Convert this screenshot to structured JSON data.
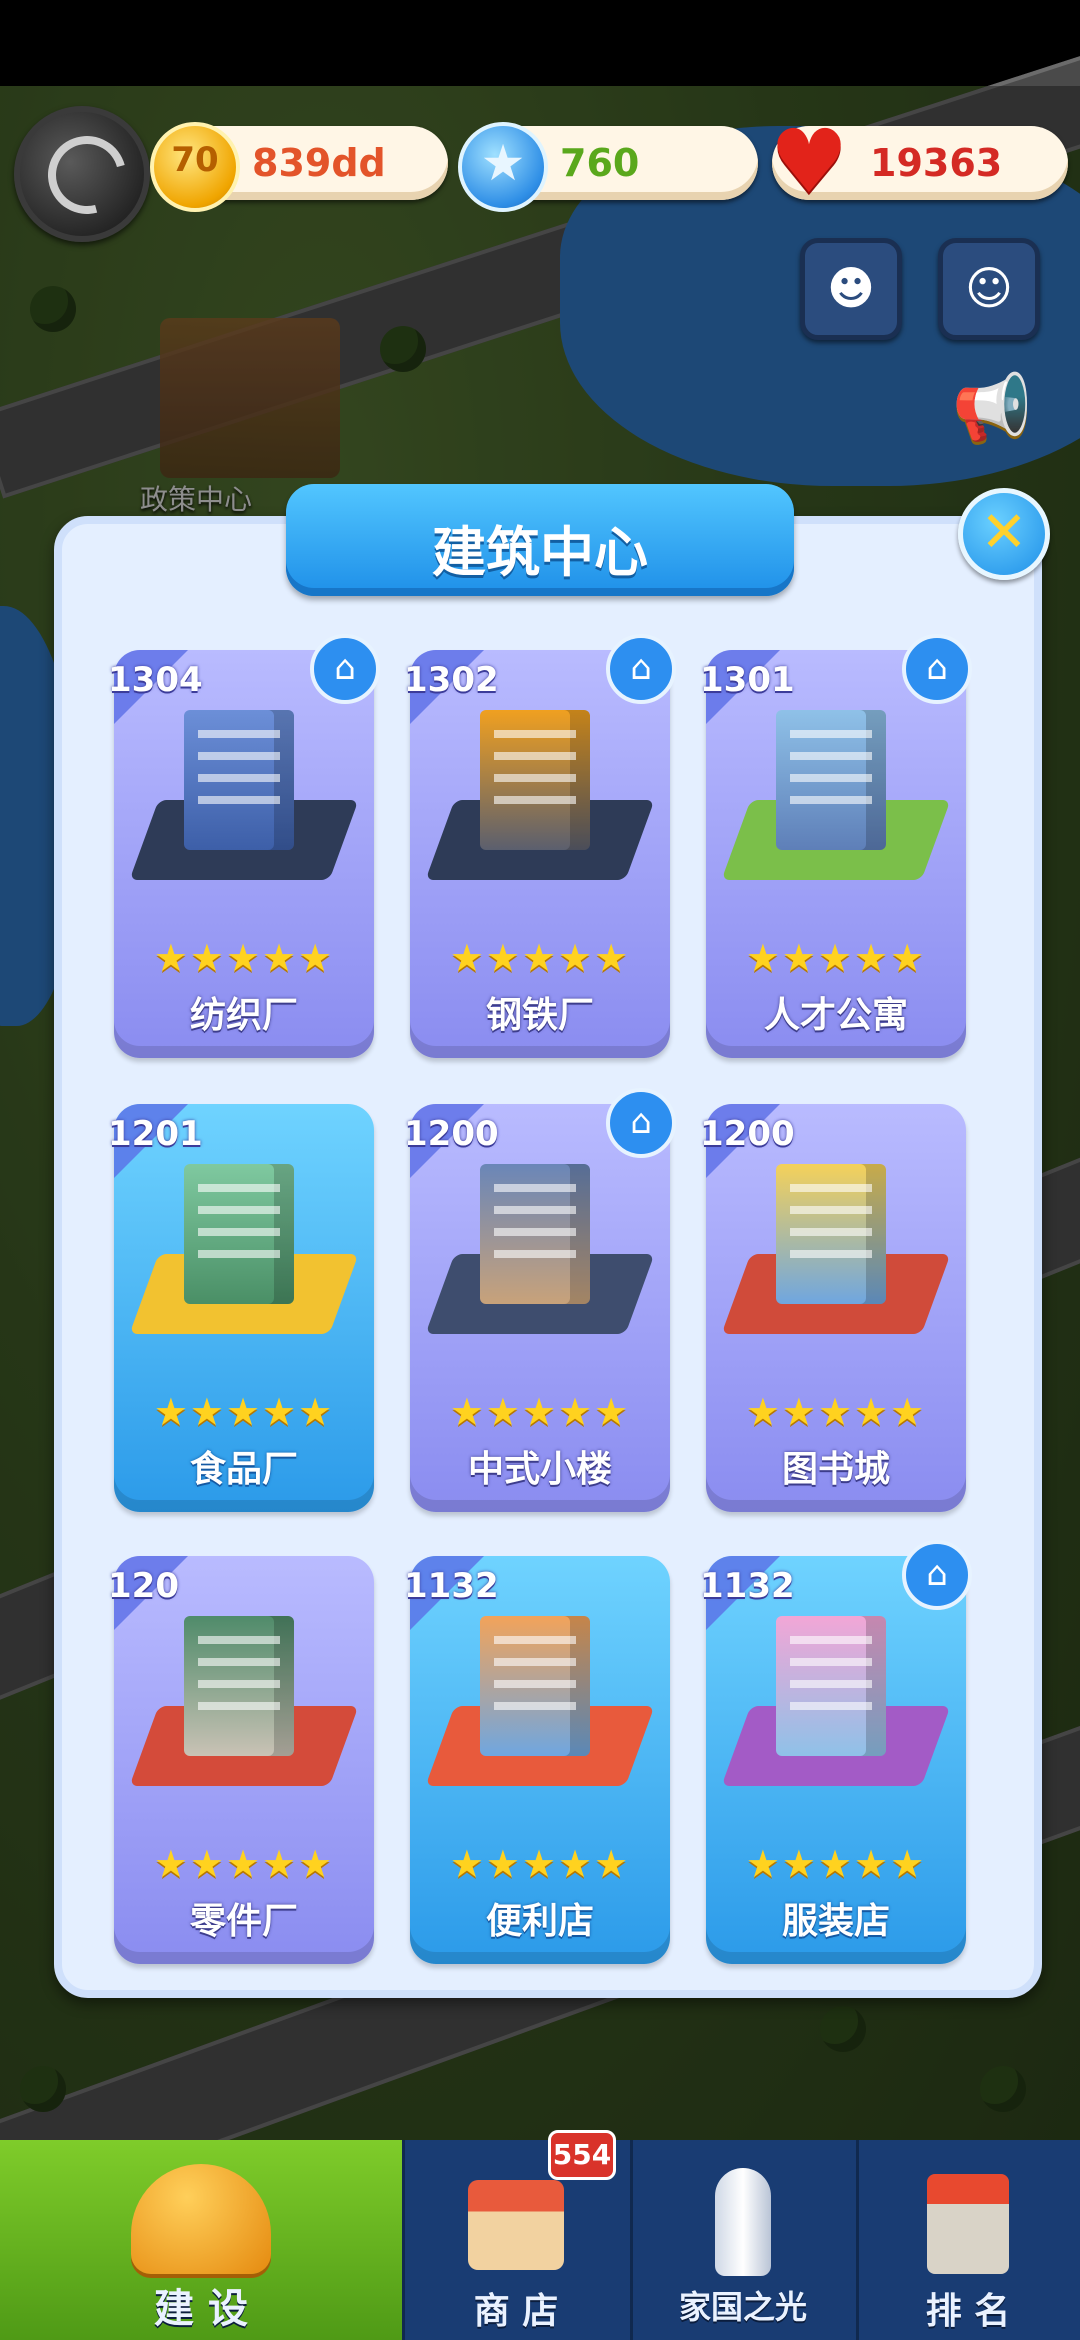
{
  "currency": {
    "coins": "839dd",
    "coin_icon_text": "70",
    "stars": "760",
    "hearts": "19363"
  },
  "map": {
    "label": "政策中心"
  },
  "modal": {
    "title": "建筑中心"
  },
  "buildings": [
    {
      "level": "1304",
      "name": "纺织厂",
      "stars": "★★★★★",
      "owned": true,
      "style": "purple"
    },
    {
      "level": "1302",
      "name": "钢铁厂",
      "stars": "★★★★★",
      "owned": true,
      "style": "purple"
    },
    {
      "level": "1301",
      "name": "人才公寓",
      "stars": "★★★★★",
      "owned": true,
      "style": "purple"
    },
    {
      "level": "1201",
      "name": "食品厂",
      "stars": "★★★★★",
      "owned": false,
      "style": "blue"
    },
    {
      "level": "1200",
      "name": "中式小楼",
      "stars": "★★★★★",
      "owned": true,
      "style": "purple"
    },
    {
      "level": "1200",
      "name": "图书城",
      "stars": "★★★★★",
      "owned": false,
      "style": "purple"
    },
    {
      "level": "120",
      "name": "零件厂",
      "stars": "★★★★★",
      "owned": false,
      "style": "purple"
    },
    {
      "level": "1132",
      "name": "便利店",
      "stars": "★★★★★",
      "owned": false,
      "style": "blue"
    },
    {
      "level": "1132",
      "name": "服装店",
      "stars": "★★★★★",
      "owned": true,
      "style": "blue"
    }
  ],
  "nav": {
    "build": "建 设",
    "shop": "商 店",
    "shop_badge": "554",
    "home_light": "家国之光",
    "rank": "排 名"
  },
  "colors": {
    "modal_bg": "#e4efff",
    "card_purple": "#8a8cf0",
    "card_blue": "#2b9ae9",
    "nav_bg": "#193c73",
    "nav_active": "#6bb822"
  }
}
